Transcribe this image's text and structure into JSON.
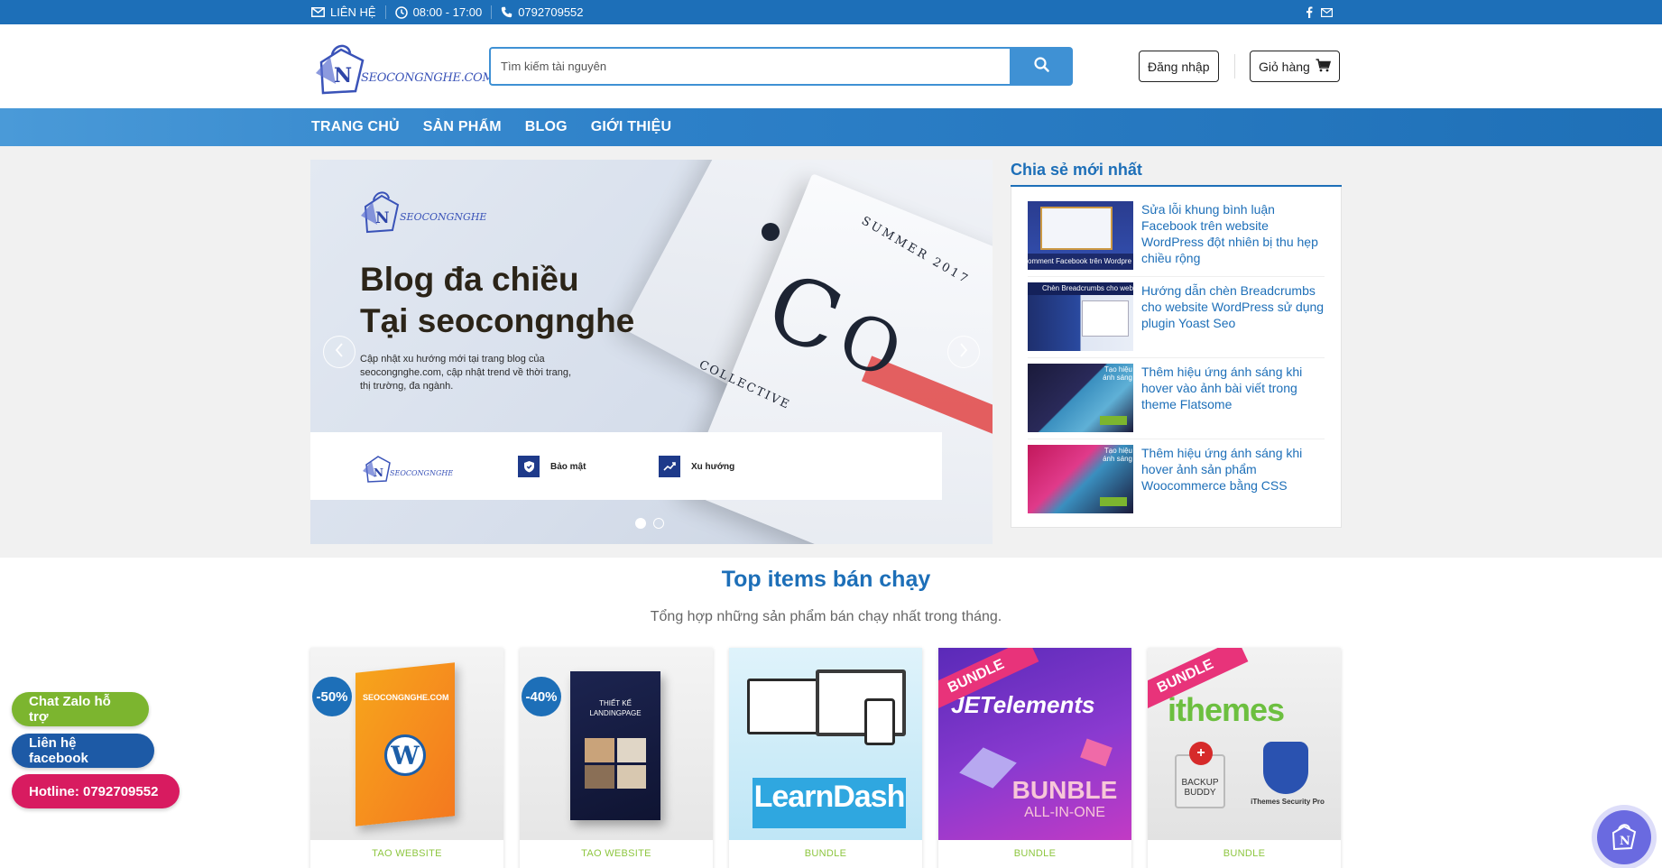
{
  "topbar": {
    "contact_label": "LIÊN HỆ",
    "hours": "08:00 - 17:00",
    "phone": "0792709552",
    "icons": [
      "envelope-icon",
      "clock-icon",
      "phone-icon",
      "facebook-icon",
      "mail-icon"
    ]
  },
  "header": {
    "logo_text": "SEOCONGNGHE.COM",
    "search_placeholder": "Tìm kiếm tài nguyên",
    "search_value": "",
    "login_label": "Đăng nhập",
    "cart_label": "Giỏ hàng"
  },
  "nav": {
    "items": [
      {
        "label": "TRANG CHỦ"
      },
      {
        "label": "SẢN PHẨM"
      },
      {
        "label": "BLOG"
      },
      {
        "label": "GIỚI THIỆU"
      }
    ]
  },
  "hero": {
    "logo_text": "SEOCONGNGHE.COM",
    "title_line1": "Blog đa chiều",
    "title_line2": "Tại seocongnghe",
    "description": "Cập nhật xu hướng mới tại trang blog của seocongnghe.com, cập nhật trend về thời trang, thị trường, đa ngành.",
    "card_logo_text": "SEOCONGNGHE.COM",
    "feature_1": "Bảo mật",
    "feature_2": "Xu hướng",
    "magazine_text": "SUMMER 2017",
    "magazine_text2": "COLLECTIVE",
    "slides_total": 2,
    "active_slide": 1
  },
  "sidebar": {
    "title": "Chia sẻ mới nhất",
    "posts": [
      {
        "title": "Sửa lỗi khung bình luận Facebook trên website WordPress đột nhiên bị thu hẹp chiều rộng",
        "thumb_caption": "omment Facebook trên Wordpre"
      },
      {
        "title": "Hướng dẫn chèn Breadcrumbs cho website WordPress sử dụng plugin Yoast Seo",
        "thumb_caption": "Chèn Breadcrumbs cho website"
      },
      {
        "title": "Thêm hiệu ứng ánh sáng khi hover vào ảnh bài viết trong theme Flatsome",
        "thumb_caption": "Tạo hiệu ánh sáng"
      },
      {
        "title": "Thêm hiệu ứng ánh sáng khi hover ảnh sản phẩm Woocommerce bằng CSS",
        "thumb_caption": "Tạo hiệu ánh sáng"
      }
    ]
  },
  "products": {
    "title": "Top items bán chạy",
    "subtitle": "Tổng hợp những sản phẩm bán chạy nhất trong tháng.",
    "items": [
      {
        "category": "TAO WEBSITE",
        "badge": "-50%",
        "image_text": "SEOCONGNGHE.COM"
      },
      {
        "category": "TAO WEBSITE",
        "badge": "-40%",
        "image_text": "THIẾT KẾ LANDINGPAGE"
      },
      {
        "category": "BUNDLE",
        "badge": "",
        "image_text": "LearnDash"
      },
      {
        "category": "BUNDLE",
        "badge": "BUNDLE",
        "image_text": "JETelements",
        "image_text2": "BUNBLE",
        "image_text3": "ALL-IN-ONE"
      },
      {
        "category": "BUNDLE",
        "badge": "BUNDLE",
        "image_text": "ithemes",
        "image_text2": "BACKUP BUDDY",
        "image_text3": "iThemes Security Pro"
      }
    ]
  },
  "floating": {
    "zalo_label": "Chat Zalo hỗ trợ",
    "facebook_label": "Liên hệ facebook",
    "hotline_label": "Hotline: 0792709552"
  },
  "colors": {
    "primary": "#1d6fb8",
    "accent_green": "#8dc63f",
    "zalo": "#7cb52f",
    "facebook": "#1d5aa6",
    "hotline": "#d81b60"
  }
}
